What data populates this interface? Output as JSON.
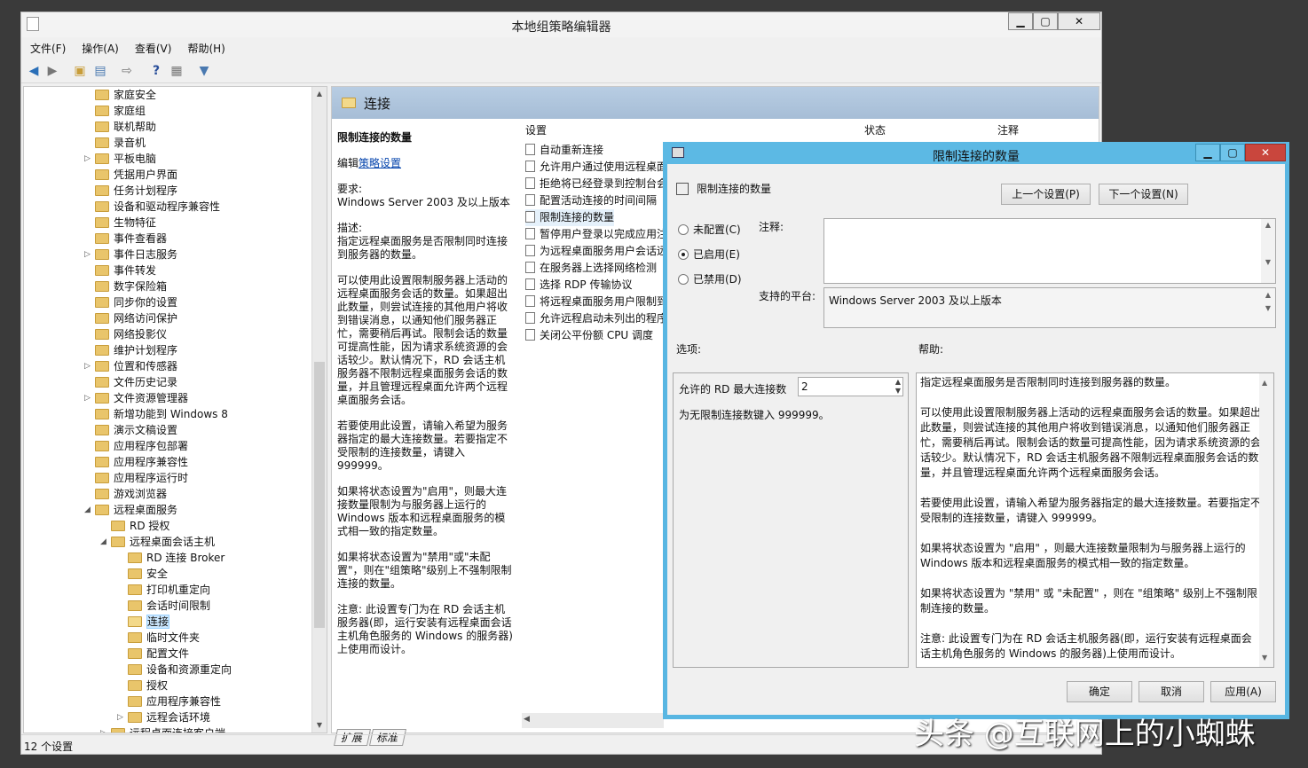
{
  "main_window": {
    "title": "本地组策略编辑器",
    "min": "▁",
    "max": "▢",
    "close": "✕"
  },
  "menu": [
    "文件(F)",
    "操作(A)",
    "查看(V)",
    "帮助(H)"
  ],
  "toolbar_icons": [
    "back-arrow-icon",
    "forward-arrow-icon",
    "up-folder-icon",
    "show-hide-tree-icon",
    "export-list-icon",
    "help-icon",
    "properties-icon",
    "filter-icon"
  ],
  "tree": {
    "items": [
      {
        "label": "家庭安全",
        "level": 0,
        "exp": ""
      },
      {
        "label": "家庭组",
        "level": 0,
        "exp": ""
      },
      {
        "label": "联机帮助",
        "level": 0,
        "exp": ""
      },
      {
        "label": "录音机",
        "level": 0,
        "exp": ""
      },
      {
        "label": "平板电脑",
        "level": 0,
        "exp": "▷"
      },
      {
        "label": "凭据用户界面",
        "level": 0,
        "exp": ""
      },
      {
        "label": "任务计划程序",
        "level": 0,
        "exp": ""
      },
      {
        "label": "设备和驱动程序兼容性",
        "level": 0,
        "exp": ""
      },
      {
        "label": "生物特征",
        "level": 0,
        "exp": ""
      },
      {
        "label": "事件查看器",
        "level": 0,
        "exp": ""
      },
      {
        "label": "事件日志服务",
        "level": 0,
        "exp": "▷"
      },
      {
        "label": "事件转发",
        "level": 0,
        "exp": ""
      },
      {
        "label": "数字保险箱",
        "level": 0,
        "exp": ""
      },
      {
        "label": "同步你的设置",
        "level": 0,
        "exp": ""
      },
      {
        "label": "网络访问保护",
        "level": 0,
        "exp": ""
      },
      {
        "label": "网络投影仪",
        "level": 0,
        "exp": ""
      },
      {
        "label": "维护计划程序",
        "level": 0,
        "exp": ""
      },
      {
        "label": "位置和传感器",
        "level": 0,
        "exp": "▷"
      },
      {
        "label": "文件历史记录",
        "level": 0,
        "exp": ""
      },
      {
        "label": "文件资源管理器",
        "level": 0,
        "exp": "▷"
      },
      {
        "label": "新增功能到 Windows 8",
        "level": 0,
        "exp": ""
      },
      {
        "label": "演示文稿设置",
        "level": 0,
        "exp": ""
      },
      {
        "label": "应用程序包部署",
        "level": 0,
        "exp": ""
      },
      {
        "label": "应用程序兼容性",
        "level": 0,
        "exp": ""
      },
      {
        "label": "应用程序运行时",
        "level": 0,
        "exp": ""
      },
      {
        "label": "游戏浏览器",
        "level": 0,
        "exp": ""
      },
      {
        "label": "远程桌面服务",
        "level": 0,
        "exp": "◢"
      },
      {
        "label": "RD 授权",
        "level": 1,
        "exp": ""
      },
      {
        "label": "远程桌面会话主机",
        "level": 1,
        "exp": "◢"
      },
      {
        "label": "RD 连接 Broker",
        "level": 2,
        "exp": ""
      },
      {
        "label": "安全",
        "level": 2,
        "exp": ""
      },
      {
        "label": "打印机重定向",
        "level": 2,
        "exp": ""
      },
      {
        "label": "会话时间限制",
        "level": 2,
        "exp": ""
      },
      {
        "label": "连接",
        "level": 2,
        "exp": "",
        "selected": true
      },
      {
        "label": "临时文件夹",
        "level": 2,
        "exp": ""
      },
      {
        "label": "配置文件",
        "level": 2,
        "exp": ""
      },
      {
        "label": "设备和资源重定向",
        "level": 2,
        "exp": ""
      },
      {
        "label": "授权",
        "level": 2,
        "exp": ""
      },
      {
        "label": "应用程序兼容性",
        "level": 2,
        "exp": ""
      },
      {
        "label": "远程会话环境",
        "level": 2,
        "exp": "▷"
      },
      {
        "label": "远程桌面连接客户端",
        "level": 1,
        "exp": "▷"
      }
    ]
  },
  "right": {
    "header": "连接",
    "desc_title": "限制连接的数量",
    "edit_prefix": "编辑",
    "edit_link": "策略设置",
    "req_label": "要求:",
    "req_value": "Windows Server 2003 及以上版本",
    "desc_label": "描述:",
    "desc_p1": "指定远程桌面服务是否限制同时连接到服务器的数量。",
    "desc_p2": "可以使用此设置限制服务器上活动的远程桌面服务会话的数量。如果超出此数量，则尝试连接的其他用户将收到错误消息，以通知他们服务器正忙，需要稍后再试。限制会话的数量可提高性能，因为请求系统资源的会话较少。默认情况下，RD 会话主机服务器不限制远程桌面服务会话的数量，并且管理远程桌面允许两个远程桌面服务会话。",
    "desc_p3": "若要使用此设置，请输入希望为服务器指定的最大连接数量。若要指定不受限制的连接数量，请键入 999999。",
    "desc_p4": "如果将状态设置为\"启用\"，则最大连接数量限制为与服务器上运行的 Windows 版本和远程桌面服务的模式相一致的指定数量。",
    "desc_p5": "如果将状态设置为\"禁用\"或\"未配置\"，则在\"组策略\"级别上不强制限制连接的数量。",
    "desc_p6": "注意: 此设置专门为在 RD 会话主机服务器(即，运行安装有远程桌面会话主机角色服务的 Windows 的服务器)上使用而设计。",
    "col_setting": "设置",
    "col_state": "状态",
    "col_comment": "注释",
    "settings": [
      "自动重新连接",
      "允许用户通过使用远程桌面",
      "拒绝将已经登录到控制台会",
      "配置活动连接的时间间隔",
      "限制连接的数量",
      "暂停用户登录以完成应用注",
      "为远程桌面服务用户会话远",
      "在服务器上选择网络检测",
      "选择 RDP 传输协议",
      "将远程桌面服务用户限制到",
      "允许远程启动未列出的程序",
      "关闭公平份额 CPU 调度"
    ],
    "tab_ext": "扩展",
    "tab_std": "标准"
  },
  "status": "12 个设置",
  "dialog": {
    "title": "限制连接的数量",
    "min": "▁",
    "max": "▢",
    "close": "✕",
    "heading": "限制连接的数量",
    "prev": "上一个设置(P)",
    "next": "下一个设置(N)",
    "r_notconf": "未配置(C)",
    "r_enabled": "已启用(E)",
    "r_disabled": "已禁用(D)",
    "comment_label": "注释:",
    "platform_label": "支持的平台:",
    "platform_value": "Windows Server 2003 及以上版本",
    "options_label": "选项:",
    "help_label": "帮助:",
    "max_label": "允许的 RD 最大连接数",
    "max_value": "2",
    "hint": "为无限制连接数键入 999999。",
    "help_p1": "指定远程桌面服务是否限制同时连接到服务器的数量。",
    "help_p2": "可以使用此设置限制服务器上活动的远程桌面服务会话的数量。如果超出此数量，则尝试连接的其他用户将收到错误消息，以通知他们服务器正忙，需要稍后再试。限制会话的数量可提高性能，因为请求系统资源的会话较少。默认情况下，RD 会话主机服务器不限制远程桌面服务会话的数量，并且管理远程桌面允许两个远程桌面服务会话。",
    "help_p3": "若要使用此设置，请输入希望为服务器指定的最大连接数量。若要指定不受限制的连接数量，请键入 999999。",
    "help_p4": "如果将状态设置为 \"启用\" ，则最大连接数量限制为与服务器上运行的 Windows 版本和远程桌面服务的模式相一致的指定数量。",
    "help_p5": "如果将状态设置为 \"禁用\" 或 \"未配置\" ，则在 \"组策略\" 级别上不强制限制连接的数量。",
    "help_p6": "注意: 此设置专门为在 RD 会话主机服务器(即，运行安装有远程桌面会话主机角色服务的 Windows 的服务器)上使用而设计。",
    "ok": "确定",
    "cancel": "取消",
    "apply": "应用(A)"
  },
  "watermark": "头条 @互联网上的小蜘蛛"
}
